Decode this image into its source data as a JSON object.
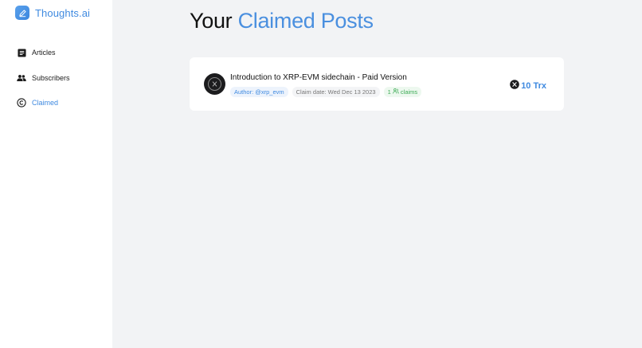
{
  "app": {
    "name": "Thoughts.ai",
    "accent": "#3f8ae0"
  },
  "sidebar": {
    "items": [
      {
        "label": "Articles",
        "icon": "article-icon",
        "active": false
      },
      {
        "label": "Subscribers",
        "icon": "people-icon",
        "active": false
      },
      {
        "label": "Claimed",
        "icon": "copyright-icon",
        "active": true
      }
    ]
  },
  "main": {
    "title_part1": "Your",
    "title_part2": "Claimed Posts",
    "posts": [
      {
        "title": "Introduction to XRP-EVM sidechain - Paid Version",
        "author": "Author: @xrp_evm",
        "claim_date": "Claim date: Wed Dec 13 2023",
        "claims_count": "1",
        "claims_label": "claims",
        "price": "10 Trx",
        "avatar_icon": "xrp-logo-icon",
        "price_icon": "xrp-coin-icon"
      }
    ]
  }
}
